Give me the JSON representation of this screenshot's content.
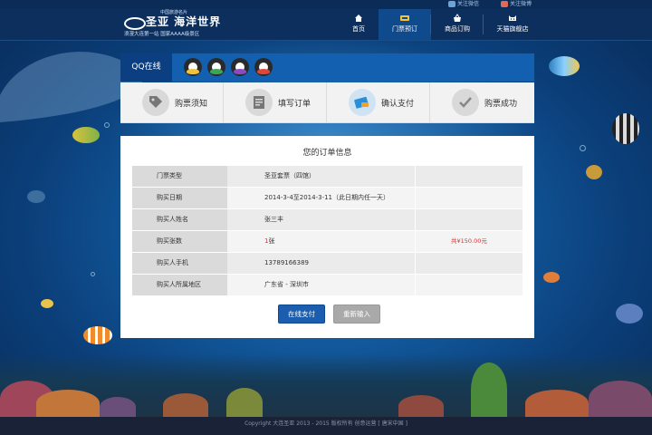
{
  "topbar": {
    "wechat_label": "关注微信",
    "weibo_label": "关注微博"
  },
  "logo": {
    "brand": "圣亚 海洋世界",
    "tagline_small": "中国旅游名片",
    "tagline": "浪漫大连第一站  国家AAAA级景区"
  },
  "nav": [
    {
      "label": "首页",
      "icon": "home-icon"
    },
    {
      "label": "门票预订",
      "icon": "ticket-icon",
      "active": true
    },
    {
      "label": "商品订购",
      "icon": "basket-icon"
    },
    {
      "label": "天猫旗舰店",
      "icon": "tmall-cat-icon"
    }
  ],
  "qq": {
    "label": "QQ在线",
    "count": 4
  },
  "steps": [
    {
      "label": "购票须知",
      "icon": "tag-icon"
    },
    {
      "label": "填写订单",
      "icon": "form-icon"
    },
    {
      "label": "确认支付",
      "icon": "card-icon"
    },
    {
      "label": "购票成功",
      "icon": "check-icon"
    }
  ],
  "order": {
    "title": "您的订单信息",
    "rows": [
      {
        "key": "门票类型",
        "value": "圣亚套票（四馆）"
      },
      {
        "key": "购买日期",
        "value": "2014-3-4至2014-3-11（此日期内任一天）"
      },
      {
        "key": "购买人姓名",
        "value": "张三丰"
      },
      {
        "key": "购买张数",
        "value_num": "1",
        "value_unit": "张",
        "total": "共¥150.00元"
      },
      {
        "key": "购买人手机",
        "value": "13789166389"
      },
      {
        "key": "购买人所属地区",
        "value": "广东省 - 深圳市"
      }
    ],
    "pay_label": "在线支付",
    "reset_label": "重新输入"
  },
  "footer": {
    "text": "Copyright 大连圣亚 2013 - 2015 版权所有  创意运营 [ 唐宋中国 ]"
  }
}
